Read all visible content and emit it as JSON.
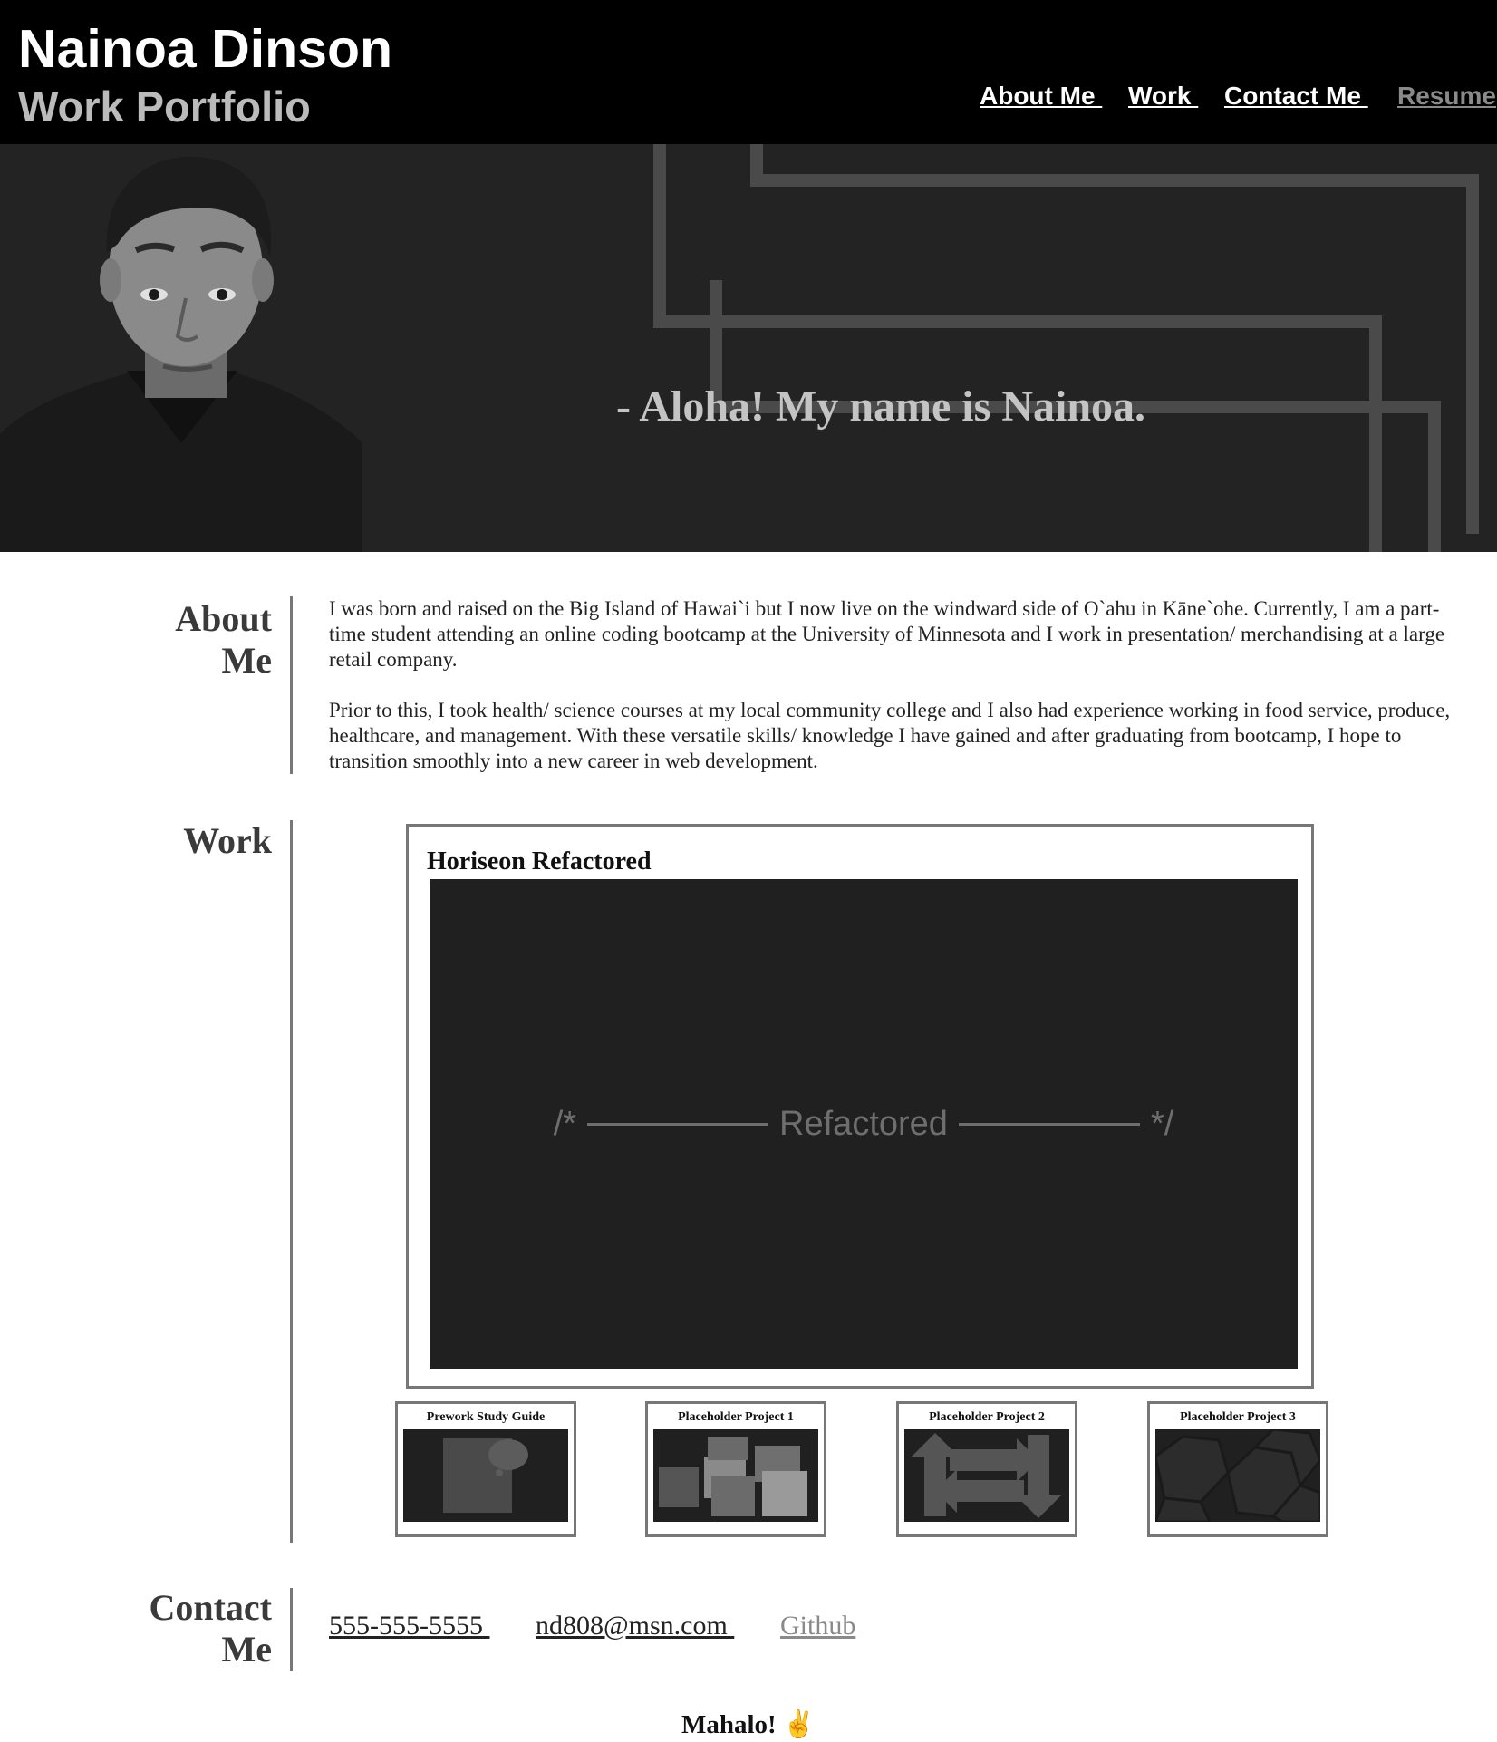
{
  "header": {
    "name": "Nainoa Dinson",
    "subtitle": "Work Portfolio",
    "nav": [
      {
        "label": "About Me "
      },
      {
        "label": "Work "
      },
      {
        "label": "Contact Me "
      },
      {
        "label": "Resume"
      }
    ],
    "nav_accent": "#ffffff",
    "nav_dim": "#8a8a8a"
  },
  "hero": {
    "greeting": "- Aloha! My name is Nainoa."
  },
  "about": {
    "heading_line1": "About",
    "heading_line2": "Me",
    "paragraphs": [
      "I was born and raised on the Big Island of Hawai`i but I now live on the windward side of O`ahu in Kāne`ohe. Currently, I am a part-time student attending an online coding bootcamp at the University of Minnesota and I work in presentation/ merchandising at a large retail company.",
      "Prior to this, I took health/ science courses at my local community college and I also had experience working in food service, produce, healthcare, and management. With these versatile skills/ knowledge I have gained and after graduating from bootcamp, I hope to transition smoothly into a new career in web development."
    ]
  },
  "work": {
    "heading": "Work",
    "featured": {
      "title": "Horiseon Refactored",
      "shot_left": "/*",
      "shot_center": "Refactored",
      "shot_right": "*/"
    },
    "cards": [
      {
        "title": "Prework Study Guide",
        "icon": "bulletin-icon"
      },
      {
        "title": "Placeholder Project 1",
        "icon": "cubes-icon"
      },
      {
        "title": "Placeholder Project 2",
        "icon": "arrows-icon"
      },
      {
        "title": "Placeholder Project 3",
        "icon": "hexagons-icon"
      }
    ]
  },
  "contact": {
    "heading_line1": "Contact",
    "heading_line2": "Me",
    "phone": "555-555-5555 ",
    "email": "nd808@msn.com ",
    "github": "Github"
  },
  "footer": {
    "text": "Mahalo!",
    "icon": "shaka-hand-icon"
  },
  "colors": {
    "header_bg": "#000000",
    "hero_bg": "#232323",
    "shot_bg": "#202020",
    "rule": "#777777"
  }
}
